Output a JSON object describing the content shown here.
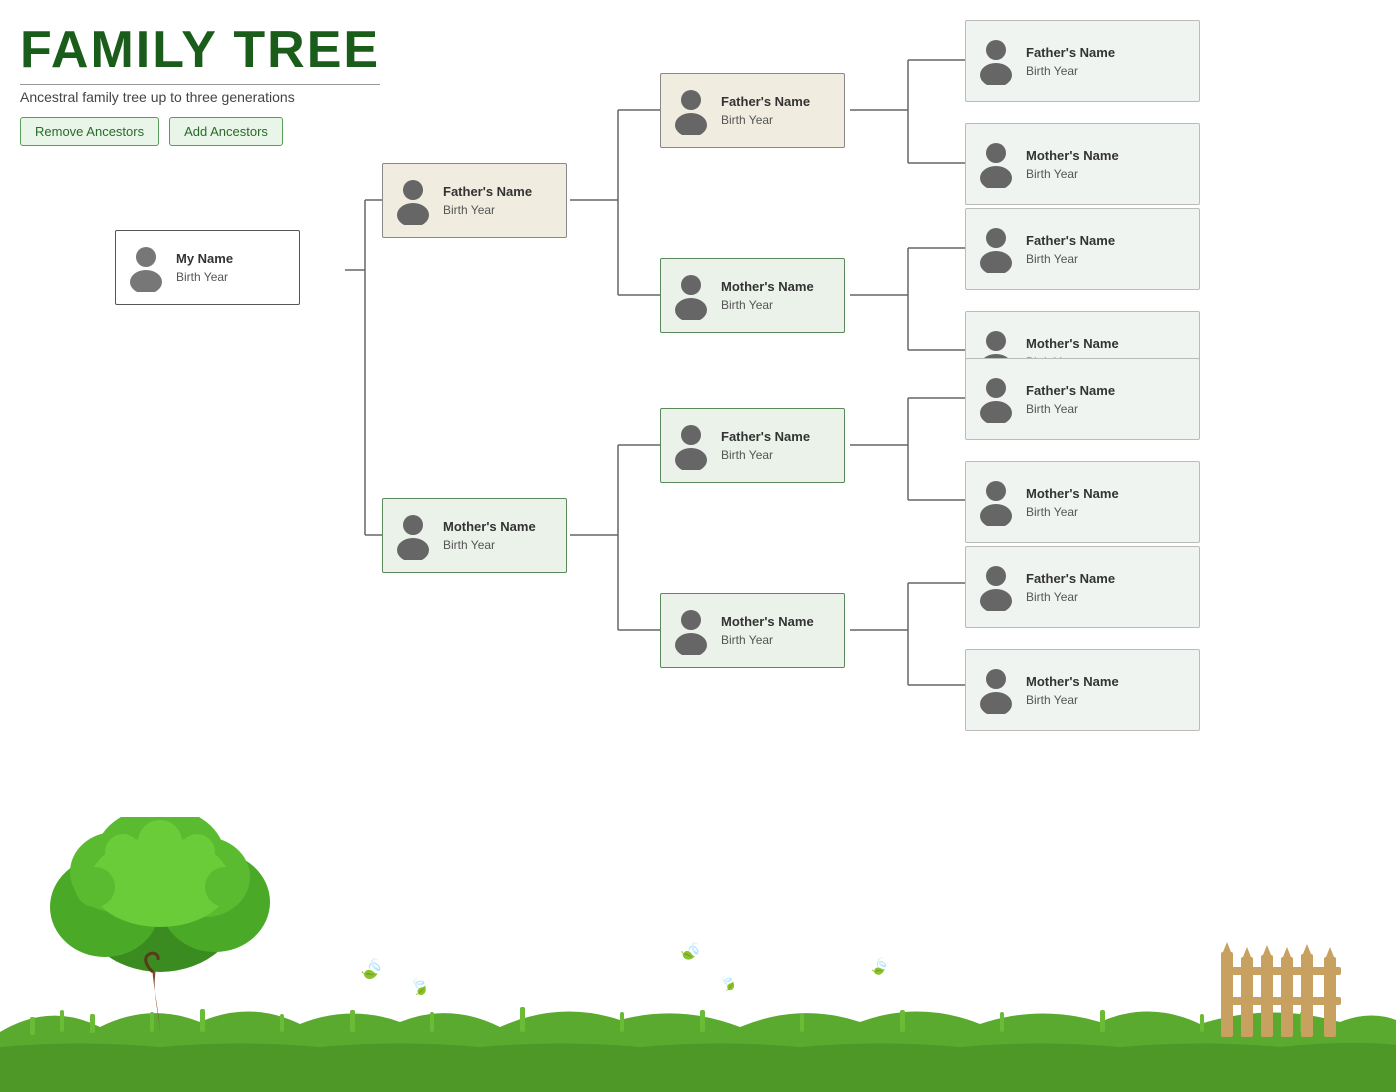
{
  "header": {
    "title": "FAMILY TREE",
    "subtitle": "Ancestral family tree up to three generations",
    "btn_remove": "Remove Ancestors",
    "btn_add": "Add Ancestors"
  },
  "persons": {
    "me": {
      "name": "My Name",
      "year": "Birth Year",
      "gen": "gen0"
    },
    "father": {
      "name": "Father's Name",
      "year": "Birth Year",
      "gen": "gen1-father"
    },
    "mother": {
      "name": "Mother's Name",
      "year": "Birth Year",
      "gen": "gen1-mother"
    },
    "ff": {
      "name": "Father's Name",
      "year": "Birth Year",
      "gen": "gen2-ff"
    },
    "fm": {
      "name": "Mother's Name",
      "year": "Birth Year",
      "gen": "gen2-fm"
    },
    "mf": {
      "name": "Father's Name",
      "year": "Birth Year",
      "gen": "gen2-mf"
    },
    "mm": {
      "name": "Mother's Name",
      "year": "Birth Year",
      "gen": "gen2-mm"
    },
    "fff": {
      "name": "Father's Name",
      "year": "Birth Year"
    },
    "ffm": {
      "name": "Mother's Name",
      "year": "Birth Year"
    },
    "fmf": {
      "name": "Father's Name",
      "year": "Birth Year"
    },
    "fmm": {
      "name": "Mother's Name",
      "year": "Birth Year"
    },
    "mff": {
      "name": "Father's Name",
      "year": "Birth Year"
    },
    "mfm": {
      "name": "Mother's Name",
      "year": "Birth Year"
    },
    "mmf": {
      "name": "Father's Name",
      "year": "Birth Year"
    },
    "mmm": {
      "name": "Mother's Name",
      "year": "Birth Year"
    }
  },
  "colors": {
    "title": "#1a5c1a",
    "btn_bg": "#e8f5e8",
    "btn_border": "#5a9c5a",
    "gen1_father_bg": "#f0ede0",
    "gen1_mother_bg": "#eaf2ea",
    "gen3_bg": "#f0f4f0"
  }
}
